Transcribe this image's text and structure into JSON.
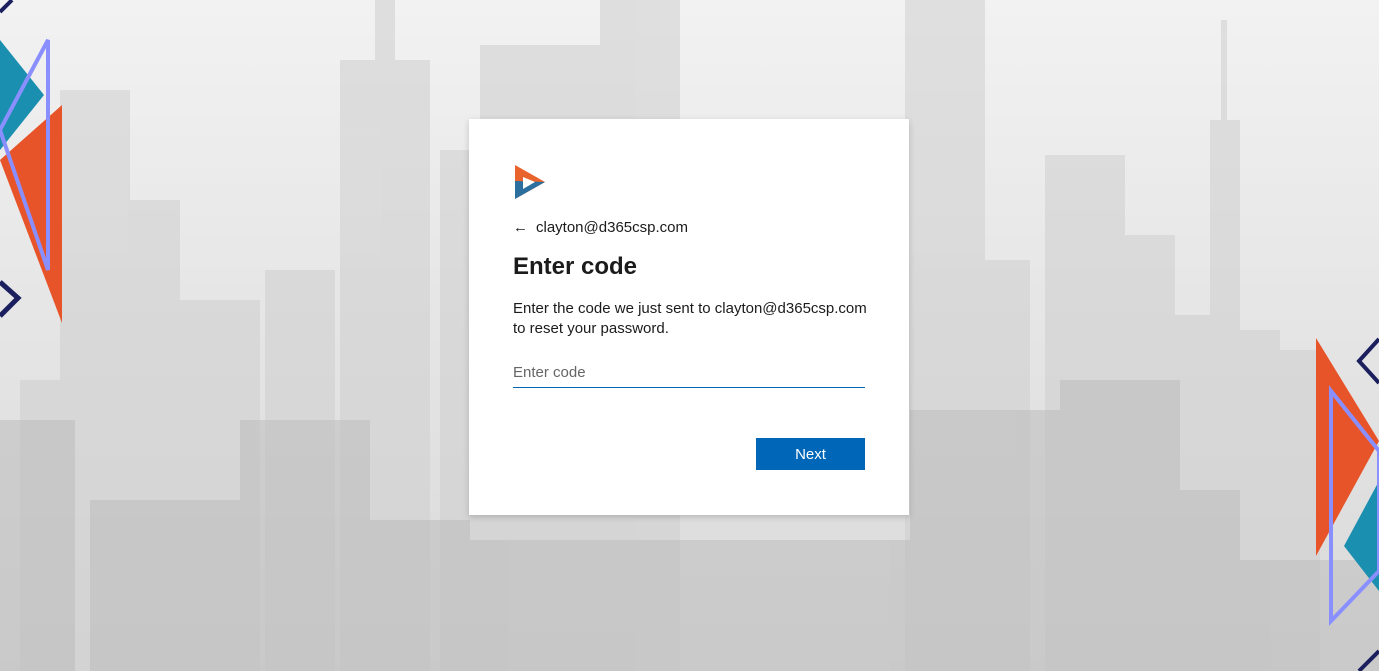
{
  "account": {
    "back_icon": "arrow-left-icon",
    "email": "clayton@d365csp.com"
  },
  "form": {
    "title": "Enter code",
    "description": "Enter the code we just sent to clayton@d365csp.com to reset your password.",
    "code_input": {
      "placeholder": "Enter code",
      "value": ""
    },
    "next_label": "Next"
  },
  "theme": {
    "accent": "#0067b8",
    "logo_orange": "#e8642c",
    "logo_blue": "#2b6f9e",
    "deco_orange": "#e8542a",
    "deco_teal": "#1a8fb0",
    "deco_navy": "#1c1f5e",
    "deco_lavender": "#8a8fff"
  }
}
